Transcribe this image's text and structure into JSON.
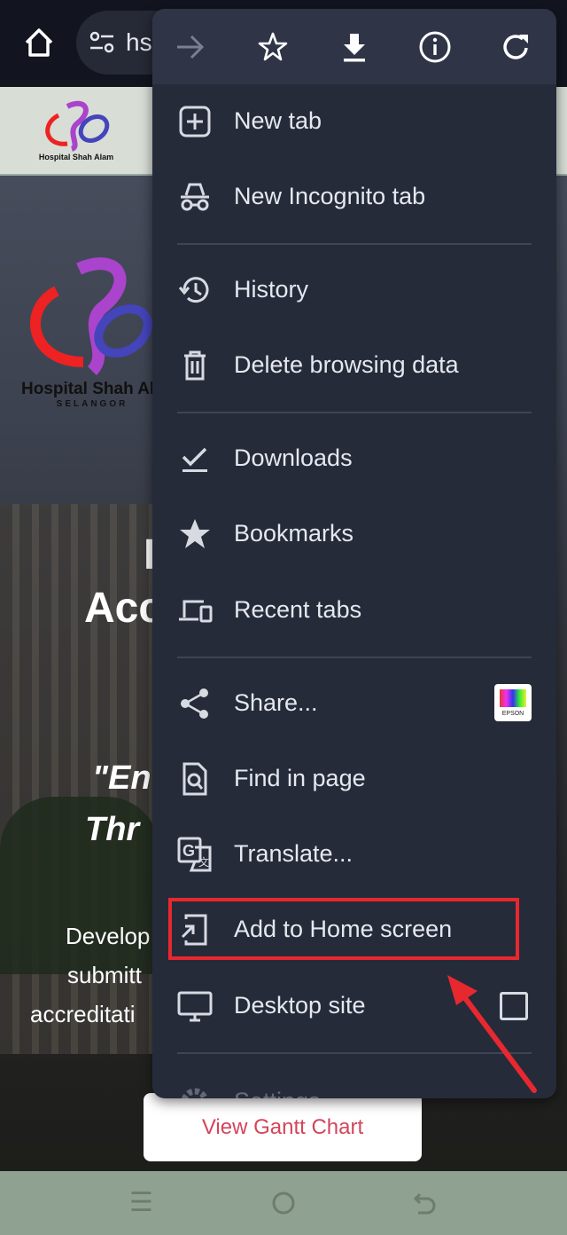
{
  "browser": {
    "url_partial": "hs"
  },
  "site": {
    "logo_name": "Hospital Shah Alam",
    "logo_sub": "SELANGOR",
    "hero_line1": "I",
    "hero_line2": "Acc",
    "quote1": "\"En",
    "quote2": "Thr",
    "desc1": "Develop",
    "desc2": "submitt",
    "desc3": "accreditati",
    "gantt_button": "View Gantt Chart"
  },
  "menu": {
    "toolbar": [
      "forward-icon",
      "bookmark-star-icon",
      "download-icon",
      "info-icon",
      "refresh-icon"
    ],
    "items": [
      {
        "label": "New tab",
        "icon": "new-tab-icon"
      },
      {
        "label": "New Incognito tab",
        "icon": "incognito-icon"
      },
      {
        "label": "History",
        "icon": "history-icon"
      },
      {
        "label": "Delete browsing data",
        "icon": "trash-icon"
      },
      {
        "label": "Downloads",
        "icon": "downloads-icon"
      },
      {
        "label": "Bookmarks",
        "icon": "star-icon"
      },
      {
        "label": "Recent tabs",
        "icon": "devices-icon"
      },
      {
        "label": "Share...",
        "icon": "share-icon"
      },
      {
        "label": "Find in page",
        "icon": "find-icon"
      },
      {
        "label": "Translate...",
        "icon": "translate-icon"
      },
      {
        "label": "Add to Home screen",
        "icon": "add-home-icon"
      },
      {
        "label": "Desktop site",
        "icon": "desktop-icon",
        "checked": false
      },
      {
        "label": "Settings",
        "icon": "gear-icon"
      }
    ],
    "share_app": "EPSON"
  },
  "annotation": {
    "highlight_color": "#e8282f"
  }
}
